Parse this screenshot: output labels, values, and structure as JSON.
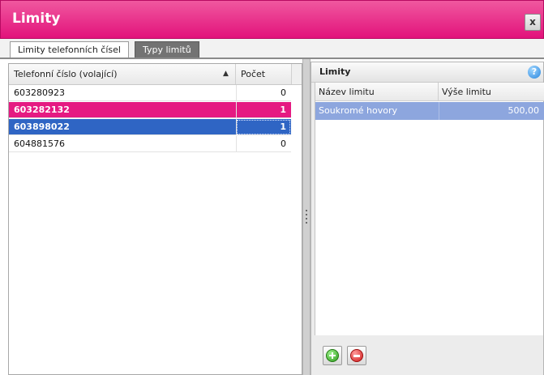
{
  "window": {
    "title": "Limity",
    "close_label": "x"
  },
  "tabs": [
    {
      "label": "Limity telefonních čísel",
      "active": true
    },
    {
      "label": "Typy limitů",
      "active": false
    }
  ],
  "left_grid": {
    "columns": [
      "Telefonní číslo (volající)",
      "Počet"
    ],
    "sort": "ascending",
    "rows": [
      {
        "number": "603280923",
        "count": "0",
        "state": "normal"
      },
      {
        "number": "603282132",
        "count": "1",
        "state": "highlighted"
      },
      {
        "number": "603898022",
        "count": "1",
        "state": "selected"
      },
      {
        "number": "604881576",
        "count": "0",
        "state": "normal"
      }
    ]
  },
  "right_panel": {
    "title": "Limity",
    "help_icon": "?",
    "columns": [
      "Název limitu",
      "Výše limitu"
    ],
    "rows": [
      {
        "name": "Soukromé hovory",
        "amount": "500,00"
      }
    ]
  },
  "toolbar": {
    "add_icon": "add-icon",
    "remove_icon": "remove-icon"
  },
  "colors": {
    "title_bar": "#e2127b",
    "highlight_row": "#e51a82",
    "selected_row": "#2f65c4",
    "right_selected_row": "#8da6de"
  }
}
